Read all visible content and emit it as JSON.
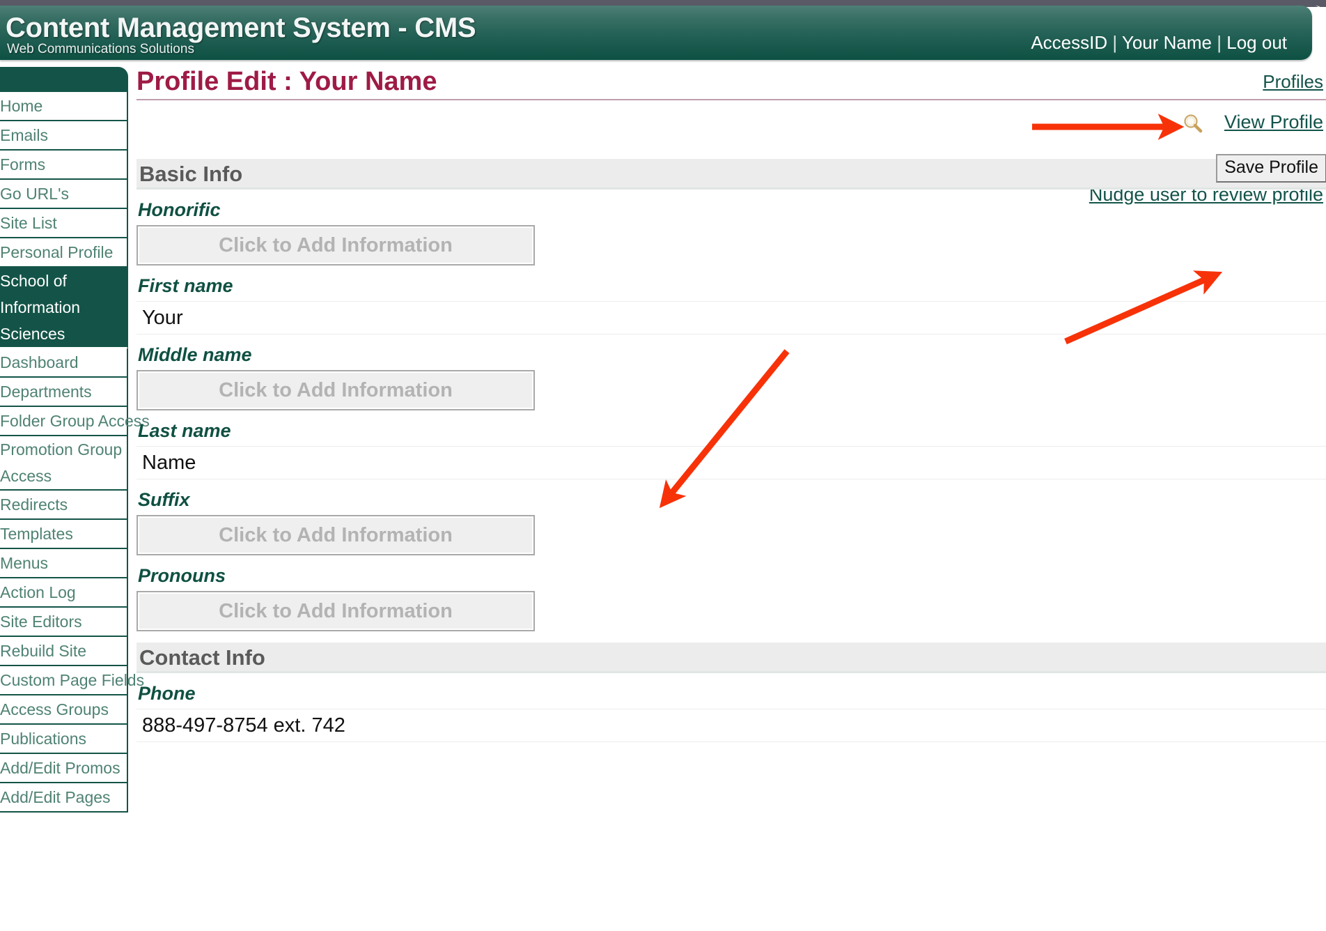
{
  "banner": {
    "title": "Content Management System - CMS",
    "subtitle": "Web Communications Solutions",
    "account_id": "AccessID",
    "user_name": "Your Name",
    "logout": "Log out",
    "separator": "|"
  },
  "sidebar": {
    "items": [
      {
        "label": "Home",
        "active": false
      },
      {
        "label": "Emails",
        "active": false
      },
      {
        "label": "Forms",
        "active": false
      },
      {
        "label": "Go URL's",
        "active": false
      },
      {
        "label": "Site List",
        "active": false
      },
      {
        "label": "Personal Profile",
        "active": false
      },
      {
        "label": "School of Information Sciences",
        "active": true
      },
      {
        "label": "Dashboard",
        "active": false
      },
      {
        "label": "Departments",
        "active": false
      },
      {
        "label": "Folder Group Access",
        "active": false
      },
      {
        "label": "Promotion Group Access",
        "active": false
      },
      {
        "label": "Redirects",
        "active": false
      },
      {
        "label": "Templates",
        "active": false
      },
      {
        "label": "Menus",
        "active": false
      },
      {
        "label": "Action Log",
        "active": false
      },
      {
        "label": "Site Editors",
        "active": false
      },
      {
        "label": "Rebuild Site",
        "active": false
      },
      {
        "label": "Custom Page Fields",
        "active": false
      },
      {
        "label": "Access Groups",
        "active": false
      },
      {
        "label": "Publications",
        "active": false
      },
      {
        "label": "Add/Edit Promos",
        "active": false
      },
      {
        "label": "Add/Edit Pages",
        "active": false
      }
    ]
  },
  "page": {
    "title": "Profile Edit : Your Name",
    "profiles_link": "Profiles",
    "view_profile_link": "View Profile",
    "view_profile_icon": "magnifying-glass-icon",
    "nudge_link": "Nudge user to review profile"
  },
  "sections": [
    {
      "title": "Basic Info",
      "save_label": "Save Profile",
      "fields": [
        {
          "label": "Honorific",
          "value": "",
          "placeholder": "Click to Add Information",
          "kind": "placeholder"
        },
        {
          "label": "First name",
          "value": "Your",
          "placeholder": "",
          "kind": "value"
        },
        {
          "label": "Middle name",
          "value": "",
          "placeholder": "Click to Add Information",
          "kind": "placeholder"
        },
        {
          "label": "Last name",
          "value": "Name",
          "placeholder": "",
          "kind": "value"
        },
        {
          "label": "Suffix",
          "value": "",
          "placeholder": "Click to Add Information",
          "kind": "placeholder"
        },
        {
          "label": "Pronouns",
          "value": "",
          "placeholder": "Click to Add Information",
          "kind": "placeholder"
        }
      ]
    },
    {
      "title": "Contact Info",
      "save_label": "",
      "fields": [
        {
          "label": "Phone",
          "value": "888-497-8754 ext. 742",
          "placeholder": "",
          "kind": "value"
        }
      ]
    }
  ],
  "annotations": {
    "arrow_color": "#f83208",
    "arrows": [
      {
        "name": "arrow-to-view-profile",
        "target": "View Profile"
      },
      {
        "name": "arrow-to-save-profile",
        "target": "Save Profile"
      },
      {
        "name": "arrow-to-middle-name",
        "target": "Middle name"
      }
    ]
  },
  "colors": {
    "brand_green": "#145448",
    "title_maroon": "#9e1b45",
    "label_green": "#0f5042",
    "section_gray": "#ececec",
    "annotation_red": "#f83208"
  }
}
